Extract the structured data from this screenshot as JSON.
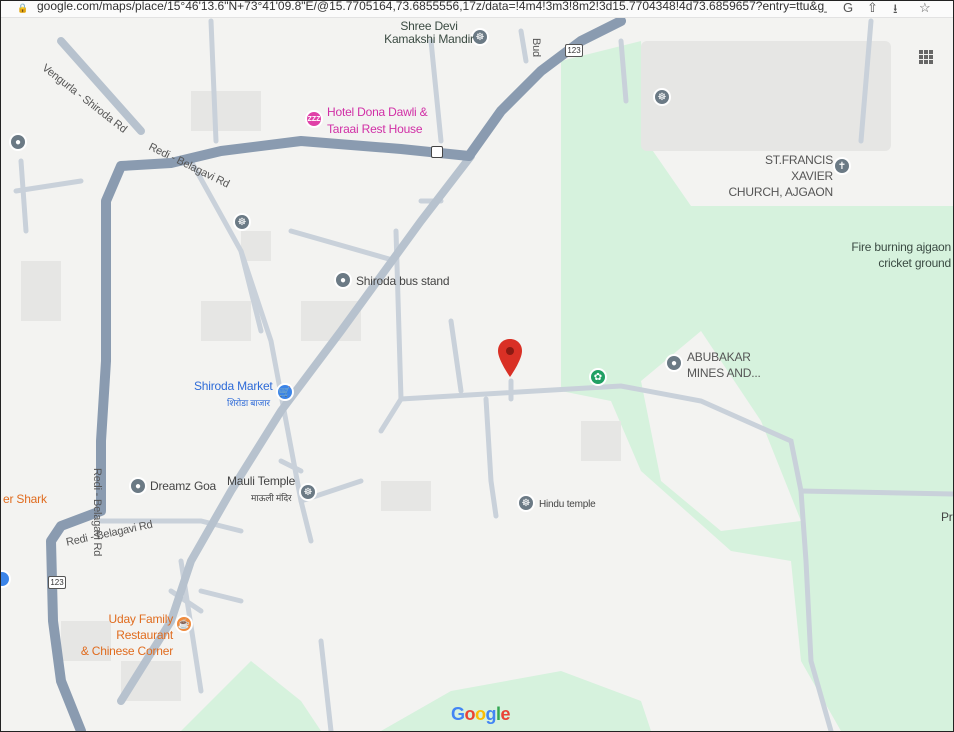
{
  "browser": {
    "url": "google.com/maps/place/15°46'13.6\"N+73°41'09.8\"E/@15.7705164,73.6855556,17z/data=!4m4!3m3!8m2!3d15.7704348!4d73.6859657?entry=ttu&g_ep=EgoyMC...",
    "icons": [
      "lock-icon",
      "google-lens-icon",
      "share-icon",
      "install-icon",
      "star-icon"
    ]
  },
  "map": {
    "colors": {
      "land": "#f3f3f1",
      "park": "#d6f2dd",
      "major_road": "#8a9bb0",
      "road": "#c9d1da",
      "building": "#e6e6e4"
    },
    "roads": [
      {
        "label": "Vengurla - Shiroda Rd"
      },
      {
        "label": "Redi - Belagavi Rd"
      },
      {
        "label": "Redi - Belagavi Rd",
        "segment": "west"
      },
      {
        "label": "Redi - Belagavi Rd",
        "segment": "south"
      },
      {
        "label": "Bud"
      }
    ],
    "shields": [
      {
        "label": "123",
        "name": "route-123-north"
      },
      {
        "label": "123",
        "name": "route-123-south"
      }
    ],
    "places": [
      {
        "name": "Shree Devi Kamakshi Mandir",
        "label": "Shree Devi\nKamakshi Mandir",
        "kind": "temple"
      },
      {
        "name": "Hotel Dona Dawli & Taraai Rest House",
        "label": "Hotel Dona Dawli &\nTaraai Rest House",
        "kind": "hotel"
      },
      {
        "name": "ST.FRANCIS XAVIER CHURCH, AJGAON",
        "label": "ST.FRANCIS XAVIER\nCHURCH, AJGAON",
        "kind": "church"
      },
      {
        "name": "Fire burning ajgaon cricket ground",
        "label": "Fire burning ajgaon\ncricket ground",
        "kind": "park"
      },
      {
        "name": "Shiroda bus stand",
        "label": "Shiroda bus stand",
        "kind": "bus"
      },
      {
        "name": "Shiroda Market",
        "label": "Shiroda Market",
        "sublabel": "शिरोडा बाजार",
        "kind": "shop"
      },
      {
        "name": "ABUBAKAR MINES AND...",
        "label": "ABUBAKAR\nMINES AND...",
        "kind": "place"
      },
      {
        "name": "Dreamz Goa",
        "label": "Dreamz Goa",
        "kind": "place"
      },
      {
        "name": "Mauli Temple",
        "label": "Mauli Temple",
        "sublabel": "माऊली मंदिर",
        "kind": "temple"
      },
      {
        "name": "Hindu temple",
        "label": "Hindu temple",
        "kind": "temple"
      },
      {
        "name": "er Shark",
        "label": "er Shark",
        "kind": "restaurant"
      },
      {
        "name": "Uday Family Restaurant & Chinese Corner",
        "label": "Uday Family Restaurant\n& Chinese Corner",
        "kind": "restaurant"
      },
      {
        "name": "Pr",
        "label": "Pr",
        "kind": "place"
      }
    ],
    "dropped_pin": {
      "color": "#d93025",
      "label": ""
    },
    "logo": "Google"
  }
}
